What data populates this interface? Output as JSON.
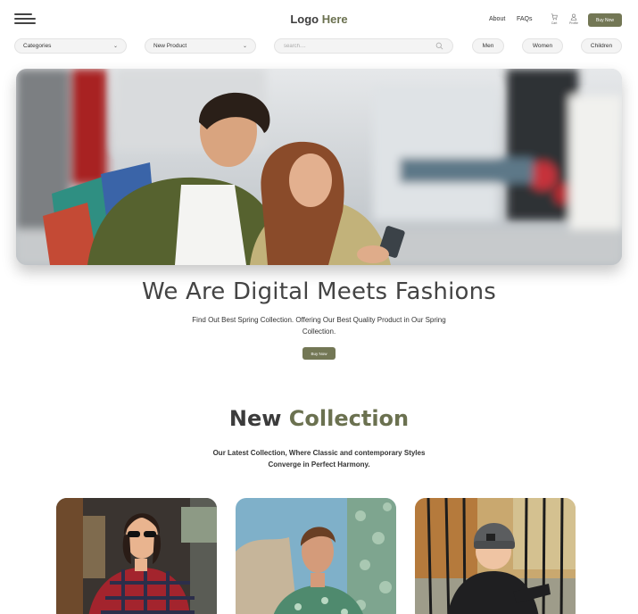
{
  "header": {
    "logo_main": "Logo",
    "logo_accent": "Here",
    "nav": {
      "about": "About",
      "faqs": "FAQs"
    },
    "icons": {
      "cart_label": "Cart",
      "profile_label": "Profile"
    },
    "buy_now": "Buy Now"
  },
  "filters": {
    "categories": "Categories",
    "new_product": "New Product",
    "search_placeholder": "search....",
    "chips": {
      "men": "Men",
      "women": "Women",
      "children": "Children"
    }
  },
  "hero": {
    "title": "We Are Digital Meets Fashions",
    "subtitle": "Find Out  Best Spring Collection. Offering Our Best Quality Product in Our Spring Collection.",
    "button": "Buy Now"
  },
  "collection": {
    "title_main": "New",
    "title_accent": "Collection",
    "subtitle": "Our Latest Collection, Where Classic and contemporary Styles Converge in Perfect Harmony."
  },
  "colors": {
    "accent": "#737755",
    "accent_text": "#6b7150",
    "text_dark": "#3b3b3b",
    "pill_bg": "#f4f4f4"
  },
  "icon_names": [
    "menu-icon",
    "cart-icon",
    "profile-icon",
    "chevron-down-icon",
    "search-icon"
  ]
}
